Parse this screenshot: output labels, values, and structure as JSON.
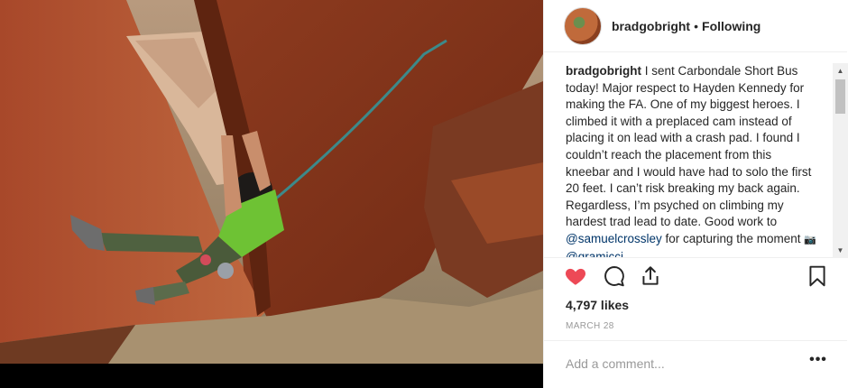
{
  "post": {
    "image_alt": "",
    "header": {
      "username": "bradgobright",
      "separator": "•",
      "follow_status": "Following"
    },
    "caption": {
      "username": "bradgobright",
      "text_1": " I sent Carbondale Short Bus today! Major respect to Hayden Kennedy for making the FA. One of my biggest heroes. I climbed it with a preplaced cam instead of placing it on lead with a crash pad. I found I couldn’t reach the placement from this kneebar and I would have had to solo the first 20 feet. I can’t risk breaking my back again. Regardless, I’m psyched on climbing my hardest trad lead to date. Good work to ",
      "mention_1": "@samuelcrossley",
      "text_2": " for capturing the moment ",
      "camera_emoji": "📷",
      "mention_2": "@gramicci"
    },
    "actions": {
      "like_icon": "heart-filled-icon",
      "comment_icon": "comment-icon",
      "share_icon": "share-icon",
      "save_icon": "bookmark-icon",
      "like_color": "#ed4956"
    },
    "likes": "4,797 likes",
    "date": "MARCH 28",
    "comment": {
      "placeholder": "Add a comment...",
      "value": "",
      "more_label": "•••"
    }
  },
  "scrollbar": {
    "up_arrow": "▲",
    "down_arrow": "▼"
  }
}
